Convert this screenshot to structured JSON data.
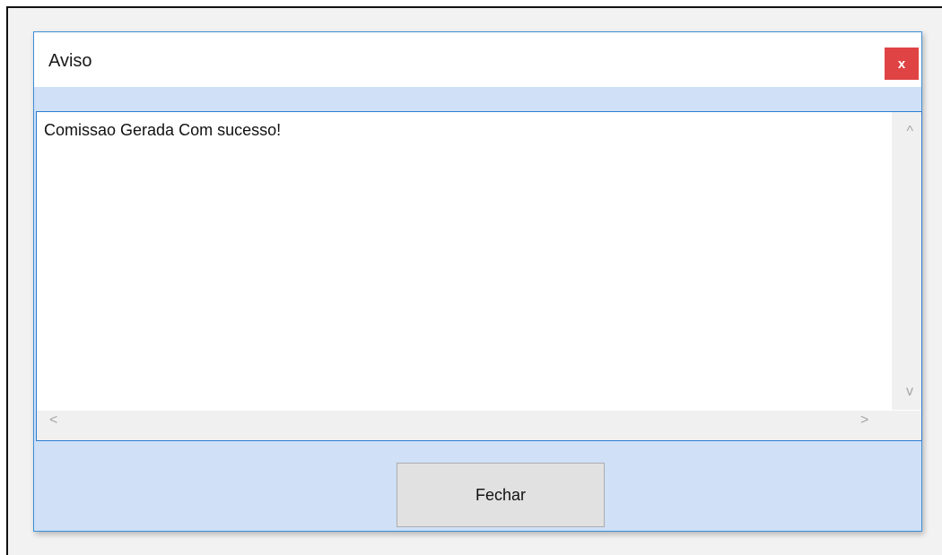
{
  "dialog": {
    "title": "Aviso",
    "close_label": "x",
    "message": "Comissao Gerada Com sucesso!",
    "close_button_label": "Fechar"
  },
  "scrollbars": {
    "up_arrow": "^",
    "down_arrow": "v",
    "left_arrow": "<",
    "right_arrow": ">"
  },
  "colors": {
    "close_button": "#e04343",
    "dialog_border": "#3c8fd8",
    "dialog_background": "#cfe0f7",
    "textbox_border": "#2c7cd3"
  }
}
